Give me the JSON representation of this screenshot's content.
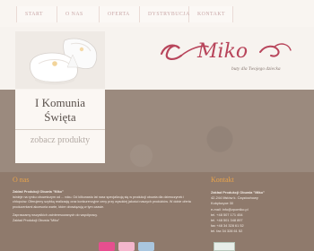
{
  "nav": {
    "items": [
      {
        "label": "START"
      },
      {
        "label": "O NAS"
      },
      {
        "label": "OFERTA"
      },
      {
        "label": "DYSTRYBUCJA"
      },
      {
        "label": "KONTAKT"
      }
    ]
  },
  "brand": {
    "logo_text": "Miko",
    "tagline": "buty dla Twojego dziecka",
    "accent": "#b8455b"
  },
  "promo": {
    "title_line1": "I Komunia",
    "title_line2": "Święta",
    "link": "zobacz produkty"
  },
  "about": {
    "title": "O nas",
    "company": "Zakład Produkcji Obuwia \"Miko\"",
    "body": "istnieje na rynku obuwniczym od ... roku. Od kilkunastu lat nasz specjalizują się w produkcji obuwia dla dziewczynek i chłopców. Oferujemy szybką realizację oraz konkurencyjne ceny przy wysokiej jakości naszych produktów. W dobie oferta producentami akcesoria warte, które obowiązują w tym czasie.",
    "footer": "Zapraszamy wszystkich zainteresowanych do współpracy.",
    "signature": "Zakład Produkcji Obuwia \"Miko\""
  },
  "contact": {
    "title": "Kontakt",
    "company": "Zakład Produkcji Obuwia \"Miko\"",
    "lines": [
      "42-244 Mstów k. Częstochowy",
      "Kobyłczyce 30",
      "e-mail: info@zpomiko.pl",
      "tel. +48 507 171 454",
      "tel. +48 501 348 897",
      "fax +48 34 328 61 52",
      "tel. fax 34 328 61 52"
    ]
  }
}
